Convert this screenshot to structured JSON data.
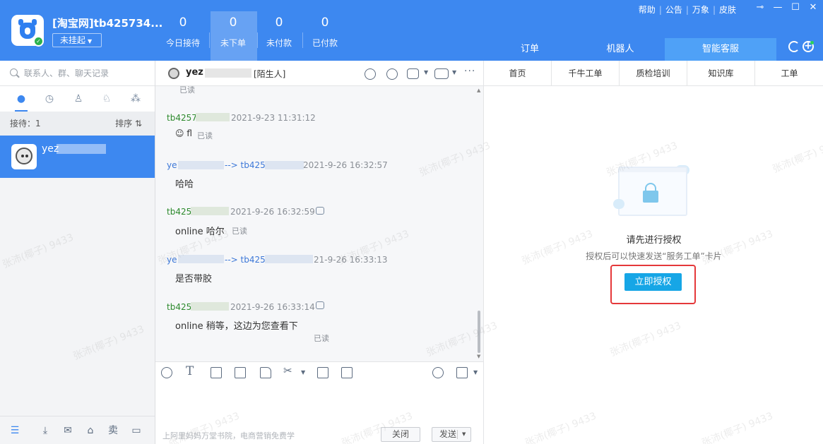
{
  "header": {
    "account_name": "[淘宝网]tb425734...",
    "status_label": "未挂起",
    "stats": [
      {
        "num": "0",
        "label": "今日接待"
      },
      {
        "num": "0",
        "label": "未下单"
      },
      {
        "num": "0",
        "label": "未付款"
      },
      {
        "num": "0",
        "label": "已付款"
      }
    ],
    "top_links": [
      "帮助",
      "公告",
      "万象",
      "皮肤"
    ],
    "right_tabs": [
      "订单",
      "机器人",
      "智能客服"
    ],
    "accent_color": "#3d88f0"
  },
  "left": {
    "search_placeholder": "联系人、群、聊天记录",
    "queue_label": "接待：1",
    "sort_label": "排序 ⇅",
    "contact_name": "yez"
  },
  "chat": {
    "contact": "yez",
    "stranger_tag": "[陌生人]",
    "messages": [
      {
        "read": "已读"
      },
      {
        "sender": "tb4257",
        "time": "2021-9-23 11:31:12",
        "text": "fl",
        "read": "已读"
      },
      {
        "sender": "ye",
        "arrow": "--> tb425",
        "time": "2021-9-26 16:32:57",
        "text": "哈哈"
      },
      {
        "sender": "tb425",
        "time": "2021-9-26 16:32:59",
        "text": "online 哈尔",
        "read": "已读"
      },
      {
        "sender": "ye",
        "arrow": "--> tb425",
        "time": "21-9-26 16:33:13",
        "text": "是否带胶"
      },
      {
        "sender": "tb425",
        "time": "2021-9-26 16:33:14",
        "text": "online 稍等，这边为您查看下",
        "read": "已读"
      }
    ],
    "promo": "上阿里妈妈万堂书院，电商营销免费学",
    "close_label": "关闭",
    "send_label": "发送"
  },
  "right": {
    "tabs": [
      "首页",
      "千牛工单",
      "质检培训",
      "知识库",
      "工单"
    ],
    "auth_title": "请先进行授权",
    "auth_sub": "授权后可以快速发送“服务工单”卡片",
    "auth_button": "立即授权",
    "highlight_color": "#e5383a"
  },
  "watermark": "张沛(椰子) 9433"
}
